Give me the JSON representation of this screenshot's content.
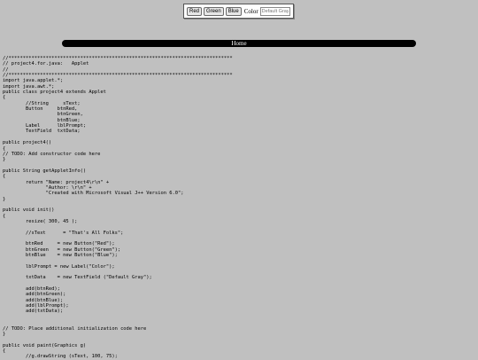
{
  "applet": {
    "buttons": [
      "Red",
      "Green",
      "Blue"
    ],
    "label": "Color",
    "textfield_value": "Default Gray"
  },
  "nav": {
    "home_label": "Home"
  },
  "code_lines": [
    "//******************************************************************************",
    "// project4.for.java:   Applet",
    "//",
    "//******************************************************************************",
    "import java.applet.*;",
    "import java.awt.*;",
    "public class project4 extends Applet",
    "{",
    "        //String     sText;",
    "        Button     btnRed,",
    "                   btnGreen,",
    "                   btnBlue;",
    "        Label      lblPrompt;",
    "        TextField  txtData;",
    "",
    "public project4()",
    "{",
    "// TODO: Add constructor code here",
    "}",
    "",
    "public String getAppletInfo()",
    "{",
    "        return \"Name: project4\\r\\n\" +",
    "               \"Author: \\r\\n\" +",
    "               \"Created with Microsoft Visual J++ Version 6.0\";",
    "}",
    "",
    "public void init()",
    "{",
    "        resize( 300, 45 );",
    "",
    "        //sText      = \"That's All Folks\";",
    "",
    "        btnRed     = new Button(\"Red\");",
    "        btnGreen   = new Button(\"Green\");",
    "        btnBlue    = new Button(\"Blue\");",
    "",
    "        lblPrompt = new Label(\"Color\");",
    "",
    "        txtData    = new TextField (\"Default Gray\");",
    "",
    "        add(btnRed);",
    "        add(btnGreen);",
    "        add(btnBlue);",
    "        add(lblPrompt);",
    "        add(txtData);",
    "",
    "",
    "// TODO: Place additional initialization code here",
    "}",
    "",
    "public void paint(Graphics g)",
    "{",
    "        //g.drawString (sText, 100, 75);"
  ]
}
